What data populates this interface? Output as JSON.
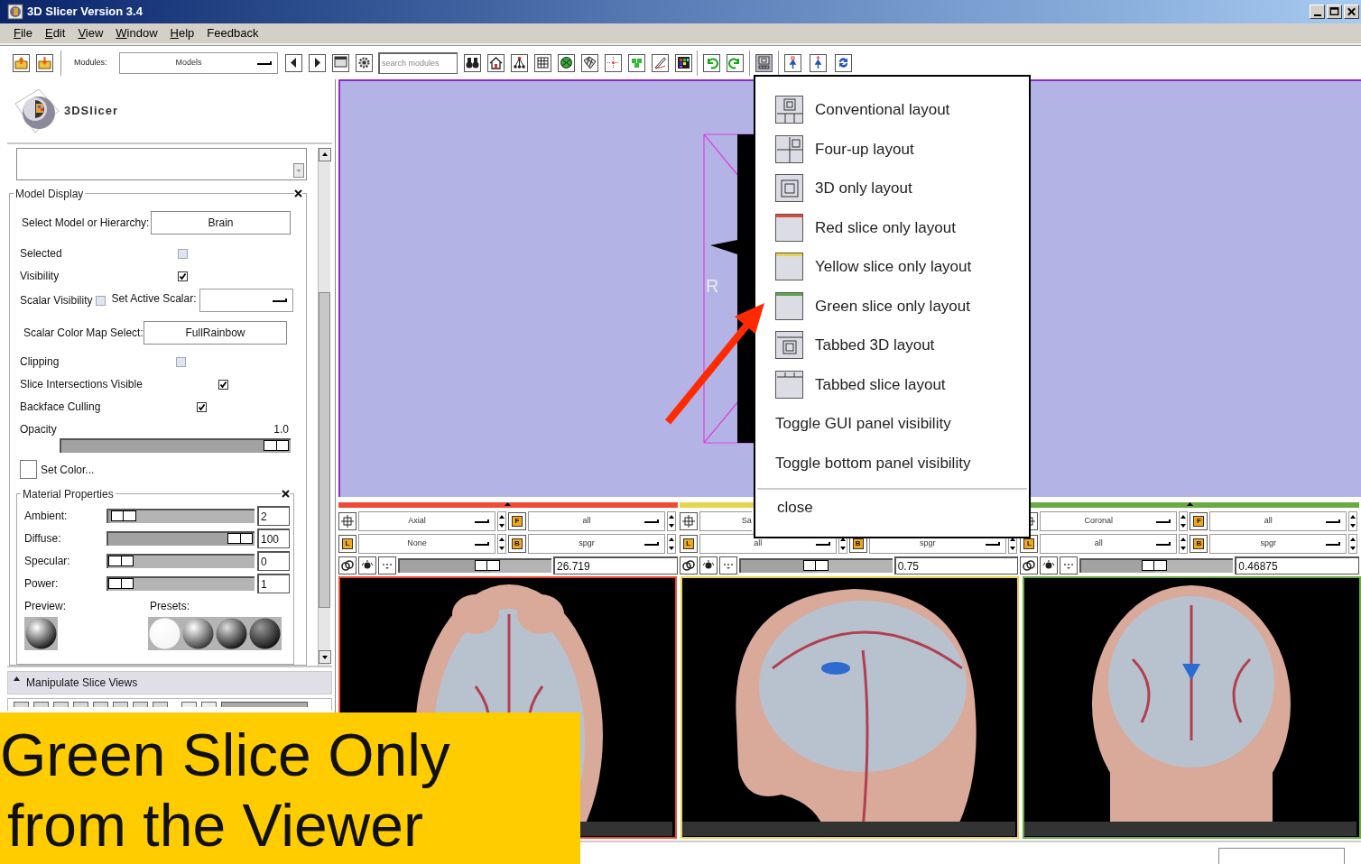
{
  "window": {
    "title": "3D Slicer Version 3.4"
  },
  "menu_bar": [
    {
      "label": "File",
      "mnemonic": true
    },
    {
      "label": "Edit",
      "mnemonic": true
    },
    {
      "label": "View",
      "mnemonic": true
    },
    {
      "label": "Window",
      "mnemonic": true
    },
    {
      "label": "Help",
      "mnemonic": true
    },
    {
      "label": "Feedback",
      "mnemonic": false
    }
  ],
  "toolbar": {
    "modules_label": "Modules:",
    "module": "Models",
    "search": {
      "placeholder": "search modules"
    },
    "layout_pressed": true
  },
  "logo": {
    "text": "3DSlicer"
  },
  "model_display": {
    "title": "Model Display",
    "model_label": "Select Model or Hierarchy:",
    "model": "Brain",
    "checks": [
      {
        "label": "Selected",
        "checked": false
      },
      {
        "label": "Visibility",
        "checked": true
      }
    ],
    "scalar_visibility": {
      "label": "Scalar Visibility",
      "checked": false
    },
    "active_scalar_label": "Set Active Scalar:",
    "color_map_label": "Scalar Color Map Select:",
    "color_map": "FullRainbow",
    "checks2": [
      {
        "label": "Clipping",
        "checked": false
      },
      {
        "label": "Slice Intersections Visible",
        "checked": true
      },
      {
        "label": "Backface Culling",
        "checked": true
      }
    ],
    "opacity": {
      "label": "Opacity",
      "reading": "1.0",
      "level": 1
    },
    "set_color": "Set Color...",
    "material": {
      "title": "Material Properties",
      "preview_label": "Preview:",
      "presets_label": "Presets:",
      "sliders": [
        {
          "label": "Ambient:",
          "level": 0.02,
          "value": "2"
        },
        {
          "label": "Diffuse:",
          "level": 1,
          "value": "100"
        },
        {
          "label": "Specular:",
          "level": 0,
          "value": "0"
        },
        {
          "label": "Power:",
          "level": 0,
          "value": "1"
        }
      ]
    }
  },
  "manipulate_panel": {
    "title": "Manipulate Slice Views"
  },
  "view3d": {
    "orientation_label": "R"
  },
  "slice_views": [
    {
      "kind": "axial",
      "color": "#f04a34",
      "orientation": "Axial",
      "fg_key": "F",
      "foreground": "all",
      "label_key": "L",
      "label_layer": "None",
      "bg_key": "B",
      "background": "spgr",
      "value": "26.719",
      "level": 0.6
    },
    {
      "kind": "sagittal",
      "color": "#e8d44b",
      "orientation": "Sa",
      "label_key": "L",
      "label_layer": "all",
      "bg_key": "B",
      "background": "spgr",
      "value": "0.75",
      "level": 0.5
    },
    {
      "kind": "coronal",
      "color": "#6aaa44",
      "orientation": "Coronal",
      "fg_key": "F",
      "foreground": "all",
      "label_key": "L",
      "label_layer": "all",
      "bg_key": "B",
      "background": "spgr",
      "value": "0.46875",
      "level": 0.48
    }
  ],
  "layout_menu": {
    "items": [
      {
        "kind": "layout",
        "label": "Conventional layout"
      },
      {
        "kind": "layout",
        "label": "Four-up layout"
      },
      {
        "kind": "layout",
        "label": "3D only layout"
      },
      {
        "kind": "layout",
        "label": "Red slice only layout",
        "color": "#e04a3a"
      },
      {
        "kind": "layout",
        "label": "Yellow slice only layout",
        "color": "#e8d44b"
      },
      {
        "kind": "layout",
        "label": "Green slice only layout",
        "color": "#5aa84a"
      },
      {
        "kind": "layout",
        "label": "Tabbed 3D layout"
      },
      {
        "kind": "layout",
        "label": "Tabbed slice layout"
      },
      {
        "kind": "action",
        "label": "Toggle GUI panel visibility"
      },
      {
        "kind": "action",
        "label": "Toggle bottom panel visibility"
      }
    ],
    "close": "close"
  },
  "caption": [
    "Green Slice Only",
    "from the Viewer"
  ]
}
